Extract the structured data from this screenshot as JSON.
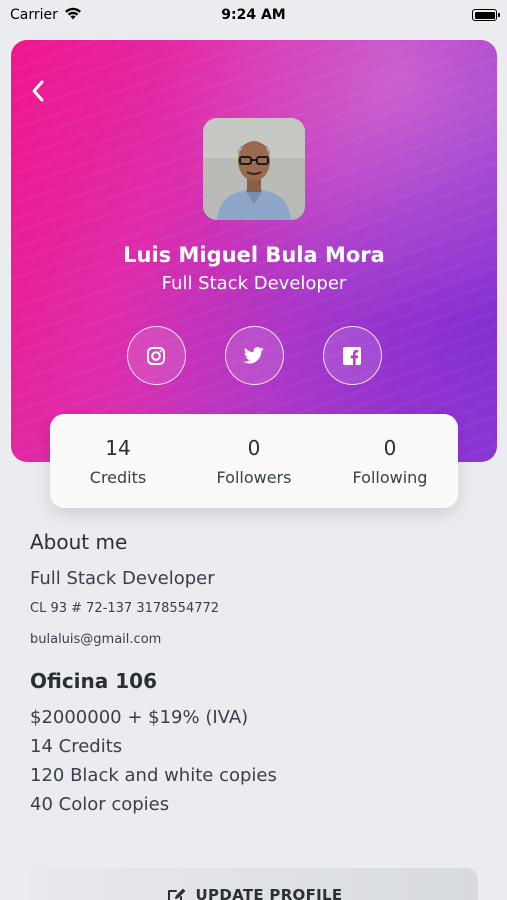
{
  "status_bar": {
    "carrier": "Carrier",
    "time": "9:24 AM"
  },
  "profile": {
    "name": "Luis Miguel Bula Mora",
    "role": "Full Stack Developer",
    "socials": [
      "instagram-icon",
      "twitter-icon",
      "facebook-icon"
    ]
  },
  "stats": [
    {
      "value": "14",
      "label": "Credits"
    },
    {
      "value": "0",
      "label": "Followers"
    },
    {
      "value": "0",
      "label": "Following"
    }
  ],
  "about": {
    "title": "About me",
    "role": "Full Stack Developer",
    "address": "CL 93 # 72-137 3178554772",
    "email": "bulaluis@gmail.com"
  },
  "office": {
    "title": "Oficina 106",
    "lines": [
      "$2000000 + $19% (IVA)",
      "14 Credits",
      "120 Black and white copies",
      "40 Color copies"
    ]
  },
  "actions": {
    "update_label": "UPDATE PROFILE"
  },
  "colors": {
    "gradient_start": "#f0168c",
    "gradient_end": "#8e3bd6",
    "background": "#eaecf0"
  }
}
